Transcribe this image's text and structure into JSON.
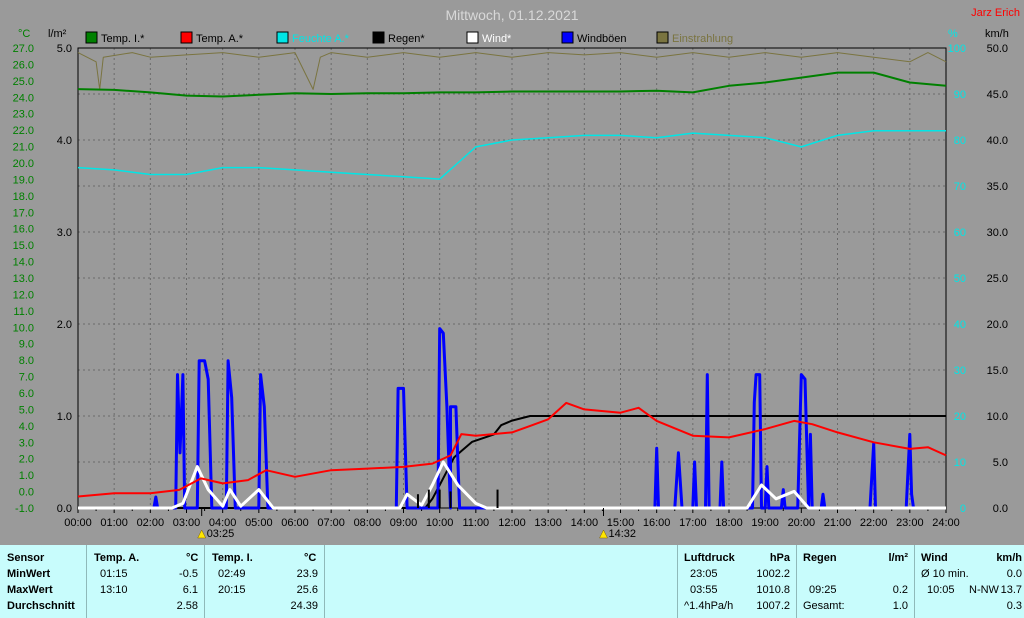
{
  "title": "Mittwoch, 01.12.2021",
  "author": "Jarz Erich",
  "colors": {
    "background": "#9a9a9a",
    "grid": "#6a6a6a",
    "temp_inside": "#008000",
    "temp_outside": "#ff0000",
    "humidity": "#00e6e6",
    "rain": "#000000",
    "wind": "#ffffff",
    "gusts": "#0000ff",
    "insolation": "#7a7440",
    "panel": "#c8fcfc"
  },
  "axes": {
    "left_unit": "°C",
    "rain_unit": "l/m²",
    "hum_unit": "%",
    "wind_unit": "km/h",
    "temp_ticks": [
      "27.0",
      "26.0",
      "25.0",
      "24.0",
      "23.0",
      "22.0",
      "21.0",
      "20.0",
      "19.0",
      "18.0",
      "17.0",
      "16.0",
      "15.0",
      "14.0",
      "13.0",
      "12.0",
      "11.0",
      "10.0",
      "9.0",
      "8.0",
      "7.0",
      "6.0",
      "5.0",
      "4.0",
      "3.0",
      "2.0",
      "1.0",
      "0.0",
      "-1.0"
    ],
    "rain_ticks": [
      "5.0",
      "4.0",
      "3.0",
      "2.0",
      "1.0",
      "0.0"
    ],
    "hum_ticks": [
      "100",
      "90",
      "80",
      "70",
      "60",
      "50",
      "40",
      "30",
      "20",
      "10",
      "0"
    ],
    "wind_ticks": [
      "50.0",
      "45.0",
      "40.0",
      "35.0",
      "30.0",
      "25.0",
      "20.0",
      "15.0",
      "10.0",
      "5.0",
      "0.0"
    ],
    "time_ticks": [
      "00:00",
      "01:00",
      "02:00",
      "03:00",
      "04:00",
      "05:00",
      "06:00",
      "07:00",
      "08:00",
      "09:00",
      "10:00",
      "11:00",
      "12:00",
      "13:00",
      "14:00",
      "15:00",
      "16:00",
      "17:00",
      "18:00",
      "19:00",
      "20:00",
      "21:00",
      "22:00",
      "23:00",
      "24:00"
    ],
    "sunrise": "03:25",
    "sunset": "14:32"
  },
  "legend": [
    {
      "label": "Temp. I.*",
      "color": "#008000"
    },
    {
      "label": "Temp. A.*",
      "color": "#ff0000"
    },
    {
      "label": "Feuchte A.*",
      "color": "#00e6e6"
    },
    {
      "label": "Regen*",
      "color": "#000000"
    },
    {
      "label": "Wind*",
      "color": "#ffffff"
    },
    {
      "label": "Windböen",
      "color": "#0000ff"
    },
    {
      "label": "Einstrahlung",
      "color": "#7a7440"
    }
  ],
  "chart_data": {
    "type": "line",
    "x_unit": "hour",
    "xlim": [
      0,
      24
    ],
    "temp_ylim": [
      -1,
      27
    ],
    "rain_ylim": [
      0,
      5
    ],
    "hum_ylim": [
      0,
      100
    ],
    "wind_ylim": [
      0,
      50
    ],
    "series": [
      {
        "name": "Temp. I.*",
        "axis": "temp",
        "color": "#008000",
        "points": [
          [
            0,
            24.5
          ],
          [
            1,
            24.45
          ],
          [
            2,
            24.3
          ],
          [
            3,
            24.1
          ],
          [
            4,
            24.05
          ],
          [
            5,
            24.15
          ],
          [
            6,
            24.25
          ],
          [
            7,
            24.2
          ],
          [
            8,
            24.25
          ],
          [
            9,
            24.25
          ],
          [
            10,
            24.3
          ],
          [
            11,
            24.3
          ],
          [
            12,
            24.35
          ],
          [
            13,
            24.35
          ],
          [
            14,
            24.35
          ],
          [
            15,
            24.35
          ],
          [
            16,
            24.4
          ],
          [
            17,
            24.3
          ],
          [
            18,
            24.7
          ],
          [
            19,
            24.9
          ],
          [
            20,
            25.2
          ],
          [
            21,
            25.5
          ],
          [
            22,
            25.5
          ],
          [
            23,
            24.9
          ],
          [
            24,
            24.7
          ]
        ]
      },
      {
        "name": "Temp. A.*",
        "axis": "temp",
        "color": "#ff0000",
        "points": [
          [
            0,
            -0.3
          ],
          [
            1,
            -0.1
          ],
          [
            2,
            -0.1
          ],
          [
            2.8,
            0.1
          ],
          [
            3.4,
            0.8
          ],
          [
            4,
            0.5
          ],
          [
            4.7,
            0.7
          ],
          [
            5.2,
            1.3
          ],
          [
            6,
            0.9
          ],
          [
            7,
            1.3
          ],
          [
            8,
            1.4
          ],
          [
            9,
            1.5
          ],
          [
            9.8,
            1.7
          ],
          [
            10.3,
            2.2
          ],
          [
            10.6,
            3.5
          ],
          [
            11,
            3.4
          ],
          [
            12,
            3.6
          ],
          [
            12.5,
            4.0
          ],
          [
            13,
            4.4
          ],
          [
            13.5,
            5.4
          ],
          [
            14,
            5.0
          ],
          [
            15,
            4.8
          ],
          [
            15.5,
            5.1
          ],
          [
            16,
            4.3
          ],
          [
            17,
            3.4
          ],
          [
            18,
            3.3
          ],
          [
            19,
            3.8
          ],
          [
            19.8,
            4.3
          ],
          [
            20.3,
            4.1
          ],
          [
            21,
            3.6
          ],
          [
            22,
            3.0
          ],
          [
            23,
            2.6
          ],
          [
            23.5,
            2.7
          ],
          [
            24,
            2.2
          ]
        ]
      },
      {
        "name": "Feuchte A.*",
        "axis": "hum",
        "color": "#00e6e6",
        "points": [
          [
            0,
            74
          ],
          [
            1,
            73.5
          ],
          [
            2,
            72.5
          ],
          [
            3,
            72.5
          ],
          [
            4,
            74
          ],
          [
            5,
            74
          ],
          [
            6,
            73.5
          ],
          [
            7,
            73
          ],
          [
            8,
            72.5
          ],
          [
            9,
            72
          ],
          [
            10,
            71.5
          ],
          [
            10.5,
            75
          ],
          [
            11,
            78.5
          ],
          [
            12,
            80
          ],
          [
            13,
            80.5
          ],
          [
            14,
            81
          ],
          [
            15,
            81
          ],
          [
            16,
            80.5
          ],
          [
            17,
            81.5
          ],
          [
            18,
            81
          ],
          [
            19,
            80.5
          ],
          [
            20,
            78.5
          ],
          [
            21,
            81
          ],
          [
            22,
            82
          ],
          [
            23,
            82
          ],
          [
            24,
            82
          ]
        ]
      },
      {
        "name": "Regen*",
        "axis": "rain",
        "color": "#000000",
        "points": [
          [
            0,
            0
          ],
          [
            9.6,
            0
          ],
          [
            9.8,
            0.1
          ],
          [
            10.0,
            0.25
          ],
          [
            10.2,
            0.4
          ],
          [
            10.4,
            0.55
          ],
          [
            10.6,
            0.62
          ],
          [
            10.9,
            0.72
          ],
          [
            11.5,
            0.8
          ],
          [
            11.7,
            0.9
          ],
          [
            12.0,
            0.95
          ],
          [
            12.5,
            1.0
          ],
          [
            24,
            1.0
          ]
        ]
      },
      {
        "name": "Wind*",
        "axis": "wind",
        "color": "#ffffff",
        "points": [
          [
            0,
            0
          ],
          [
            2.6,
            0
          ],
          [
            2.9,
            0.5
          ],
          [
            3.3,
            4.5
          ],
          [
            3.6,
            2
          ],
          [
            4,
            0.2
          ],
          [
            4.2,
            2
          ],
          [
            4.5,
            0.2
          ],
          [
            5,
            2
          ],
          [
            5.4,
            0
          ],
          [
            8.9,
            0
          ],
          [
            9.1,
            1.5
          ],
          [
            9.5,
            0.3
          ],
          [
            9.8,
            2.5
          ],
          [
            10.1,
            5
          ],
          [
            10.5,
            2.5
          ],
          [
            11.0,
            0.5
          ],
          [
            11.3,
            0
          ],
          [
            18.5,
            0
          ],
          [
            18.9,
            2.5
          ],
          [
            19.3,
            1
          ],
          [
            19.8,
            1.8
          ],
          [
            20.2,
            0
          ],
          [
            24,
            0
          ]
        ]
      },
      {
        "name": "Windböen",
        "axis": "wind",
        "color": "#0000ff",
        "points": [
          [
            0,
            0
          ],
          [
            2.1,
            0
          ],
          [
            2.15,
            1.2
          ],
          [
            2.2,
            0
          ],
          [
            2.7,
            0
          ],
          [
            2.75,
            14.5
          ],
          [
            2.82,
            6
          ],
          [
            2.9,
            14.5
          ],
          [
            2.95,
            0
          ],
          [
            3.3,
            0
          ],
          [
            3.35,
            16
          ],
          [
            3.5,
            16
          ],
          [
            3.6,
            14
          ],
          [
            3.7,
            0
          ],
          [
            4.1,
            0
          ],
          [
            4.15,
            16
          ],
          [
            4.25,
            12
          ],
          [
            4.35,
            0
          ],
          [
            5.0,
            0
          ],
          [
            5.05,
            14.5
          ],
          [
            5.15,
            11
          ],
          [
            5.25,
            0
          ],
          [
            8.8,
            0
          ],
          [
            8.85,
            13
          ],
          [
            9.0,
            13
          ],
          [
            9.1,
            0
          ],
          [
            9.95,
            0
          ],
          [
            10.0,
            19.5
          ],
          [
            10.1,
            19
          ],
          [
            10.2,
            11
          ],
          [
            10.3,
            0
          ],
          [
            10.3,
            11
          ],
          [
            10.45,
            11
          ],
          [
            10.55,
            0
          ],
          [
            15.95,
            0
          ],
          [
            16.0,
            6.5
          ],
          [
            16.05,
            0
          ],
          [
            16.5,
            0
          ],
          [
            16.6,
            6
          ],
          [
            16.7,
            0
          ],
          [
            17.0,
            0
          ],
          [
            17.05,
            5
          ],
          [
            17.1,
            0
          ],
          [
            17.35,
            0
          ],
          [
            17.4,
            14.5
          ],
          [
            17.45,
            0
          ],
          [
            17.75,
            0
          ],
          [
            17.8,
            5
          ],
          [
            17.85,
            0
          ],
          [
            18.65,
            0
          ],
          [
            18.7,
            11.5
          ],
          [
            18.75,
            14.5
          ],
          [
            18.85,
            14.5
          ],
          [
            18.9,
            0
          ],
          [
            19.0,
            0
          ],
          [
            19.05,
            4.5
          ],
          [
            19.1,
            0
          ],
          [
            19.45,
            0
          ],
          [
            19.5,
            2
          ],
          [
            19.55,
            0
          ],
          [
            19.9,
            0
          ],
          [
            20.0,
            14.5
          ],
          [
            20.1,
            14
          ],
          [
            20.2,
            0
          ],
          [
            20.25,
            8
          ],
          [
            20.3,
            0
          ],
          [
            20.55,
            0
          ],
          [
            20.6,
            1.5
          ],
          [
            20.65,
            0
          ],
          [
            21.9,
            0
          ],
          [
            22.0,
            7
          ],
          [
            22.05,
            0
          ],
          [
            22.9,
            0
          ],
          [
            23.0,
            8
          ],
          [
            23.05,
            1.5
          ],
          [
            23.1,
            0
          ],
          [
            24,
            0
          ]
        ]
      },
      {
        "name": "Einstrahlung",
        "axis": "hum",
        "color": "#7a7440",
        "points": [
          [
            0,
            99
          ],
          [
            0.5,
            97
          ],
          [
            0.6,
            91
          ],
          [
            0.7,
            98
          ],
          [
            1.5,
            99
          ],
          [
            2,
            98
          ],
          [
            3,
            98.5
          ],
          [
            4,
            99
          ],
          [
            5,
            98
          ],
          [
            6,
            99
          ],
          [
            6.5,
            91
          ],
          [
            6.7,
            98
          ],
          [
            7,
            99
          ],
          [
            8,
            98
          ],
          [
            9,
            99
          ],
          [
            10,
            98
          ],
          [
            11,
            99
          ],
          [
            12,
            98
          ],
          [
            13,
            99
          ],
          [
            14,
            98.5
          ],
          [
            15,
            99
          ],
          [
            16,
            98
          ],
          [
            17,
            99
          ],
          [
            18,
            98
          ],
          [
            19,
            99
          ],
          [
            20,
            98
          ],
          [
            21,
            99
          ],
          [
            22,
            98
          ],
          [
            23,
            97
          ],
          [
            23.5,
            99
          ],
          [
            24,
            97
          ]
        ]
      }
    ]
  },
  "stats": {
    "temp_a": {
      "sensor": "Sensor",
      "title": "Temp. A.",
      "unit": "°C",
      "min_label": "MinWert",
      "max_label": "MaxWert",
      "avg_label": "Durchschnitt",
      "min_time": "01:15",
      "min_val": "-0.5",
      "max_time": "13:10",
      "max_val": "6.1",
      "avg": "2.58"
    },
    "temp_i": {
      "title": "Temp. I.",
      "unit": "°C",
      "min_time": "02:49",
      "min_val": "23.9",
      "max_time": "20:15",
      "max_val": "25.6",
      "avg": "24.39"
    },
    "pressure": {
      "title": "Luftdruck",
      "unit": "hPa",
      "min_time": "23:05",
      "min_val": "1002.2",
      "max_time": "03:55",
      "max_val": "1010.8",
      "trend": "^1.4hPa/h",
      "current": "1007.2"
    },
    "rain": {
      "title": "Regen",
      "unit": "l/m²",
      "max_time": "09:25",
      "max_val": "0.2",
      "total_label": "Gesamt:",
      "total": "1.0"
    },
    "wind": {
      "title": "Wind",
      "unit": "km/h",
      "avg_label": "Ø 10 min.",
      "avg_val": "0.0",
      "max_time": "10:05",
      "max_dir": "N-NW",
      "max_val": "13.7",
      "current": "0.3"
    }
  }
}
